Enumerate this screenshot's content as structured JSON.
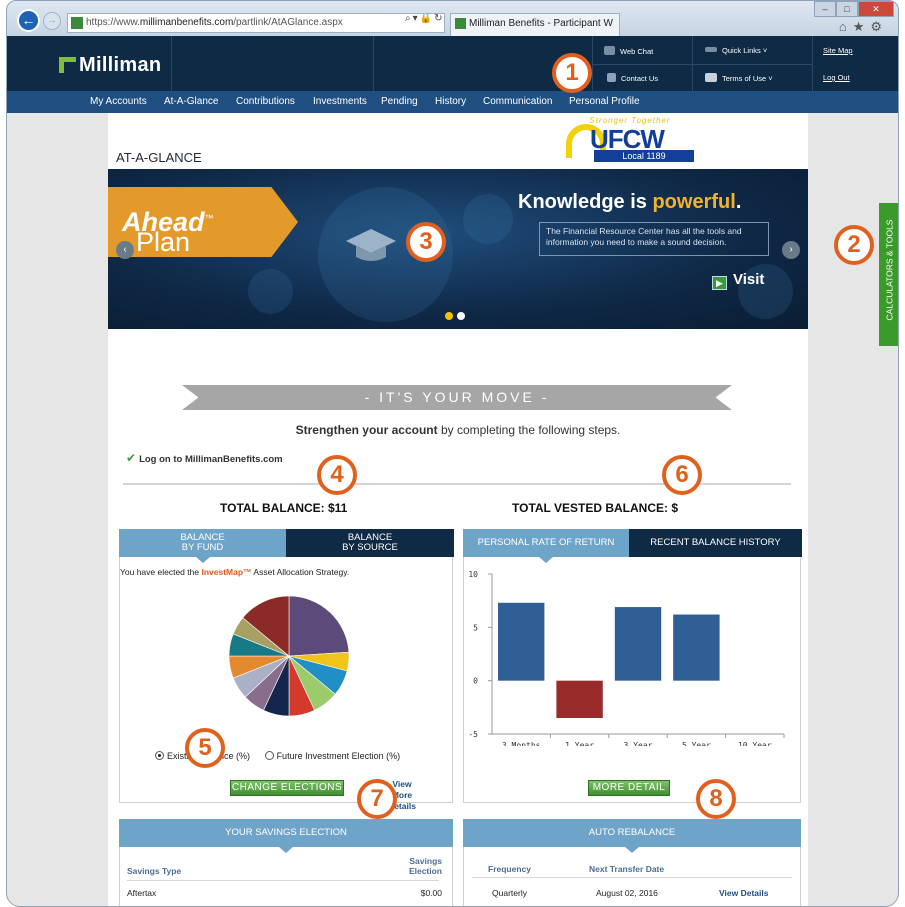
{
  "browser": {
    "url_prefix": "https://www.",
    "url_domain": "millimanbenefits.com",
    "url_path": "/partlink/AtAGlance.aspx",
    "tab_title": "Milliman Benefits - Participant W"
  },
  "header": {
    "logo": "Milliman",
    "web_chat": "Web Chat",
    "quick_links": "Quick Links",
    "site_map": "Site Map",
    "contact_us": "Contact Us",
    "terms_of_use": "Terms of Use",
    "log_out": "Log Out"
  },
  "nav": {
    "items": [
      "My Accounts",
      "At-A-Glance",
      "Contributions",
      "Investments",
      "Pending",
      "History",
      "Communication",
      "Personal Profile"
    ]
  },
  "page": {
    "title": "AT-A-GLANCE",
    "union_top": "Stronger Together",
    "union_name": "UFCW",
    "union_local": "Local 1189"
  },
  "banner": {
    "plan": "Plan",
    "ahead": "Ahead",
    "tm": "™",
    "headline_start": "Knowledge is ",
    "headline_highlight": "powerful",
    "headline_end": ".",
    "body": "The Financial Resource Center has all the tools and information you need to make a sound decision.",
    "visit": "Visit",
    "prev": "‹",
    "next": "›"
  },
  "move": {
    "title": "- IT'S YOUR MOVE -",
    "steps_bold": "Strengthen your account",
    "steps_rest": " by completing the following steps.",
    "logon": "Log on to MillimanBenefits.com"
  },
  "balances": {
    "total_label": "TOTAL BALANCE: $11",
    "vested_label": "TOTAL VESTED BALANCE: $"
  },
  "fund_panel": {
    "tab_fund_1": "BALANCE",
    "tab_fund_2": "BY FUND",
    "tab_source_1": "BALANCE",
    "tab_source_2": "BY SOURCE",
    "elected_pre": "You have elected the ",
    "elected_brand": "InvestMap™",
    "elected_post": " Asset Allocation Strategy.",
    "radio_existing": "Existing Balance (%)",
    "radio_future": "Future Investment Election (%)",
    "change_button": "CHANGE ELECTIONS",
    "view_more_1": "View More",
    "view_more_2": "Details"
  },
  "return_panel": {
    "tab_rate": "PERSONAL RATE OF RETURN",
    "tab_history": "RECENT BALANCE HISTORY",
    "more_button": "MORE DETAIL"
  },
  "savings": {
    "header": "YOUR SAVINGS ELECTION",
    "col_type": "Savings Type",
    "col_election_1": "Savings",
    "col_election_2": "Election",
    "row_type": "Aftertax",
    "row_value": "$0.00"
  },
  "rebalance": {
    "header": "AUTO REBALANCE",
    "col_frequency": "Frequency",
    "col_next": "Next Transfer Date",
    "row_frequency": "Quarterly",
    "row_next": "August 02, 2016",
    "row_link": "View Details"
  },
  "sidebar": {
    "label": "CALCULATORS & TOOLS"
  },
  "callouts": [
    "1",
    "2",
    "3",
    "4",
    "5",
    "6",
    "7",
    "8"
  ],
  "colors": {
    "navy": "#0e2a44",
    "nav_blue": "#1f4f80",
    "panel_blue": "#6fa4c9",
    "accent_orange": "#e0611d",
    "green": "#3f8f2f"
  },
  "chart_data": [
    {
      "type": "pie",
      "title": "",
      "slices": [
        {
          "value": 24,
          "color": "#5b4a7a"
        },
        {
          "value": 5,
          "color": "#f0c419"
        },
        {
          "value": 7,
          "color": "#1f8fc5"
        },
        {
          "value": 7,
          "color": "#9ccb6b"
        },
        {
          "value": 7,
          "color": "#d33a2c"
        },
        {
          "value": 7,
          "color": "#13274d"
        },
        {
          "value": 6,
          "color": "#8a6c8c"
        },
        {
          "value": 6,
          "color": "#aab1c7"
        },
        {
          "value": 6,
          "color": "#e3892f"
        },
        {
          "value": 6,
          "color": "#177a86"
        },
        {
          "value": 5,
          "color": "#a7a062"
        },
        {
          "value": 14,
          "color": "#8b2a26"
        }
      ]
    },
    {
      "type": "bar",
      "title": "",
      "categories": [
        "3 Months",
        "1 Year",
        "3 Year",
        "5 Year",
        "10 Year"
      ],
      "values": [
        7.3,
        -3.5,
        6.9,
        6.2,
        null
      ],
      "colors": [
        "#2f5f94",
        "#9a2b2b",
        "#2f5f94",
        "#2f5f94",
        "#2f5f94"
      ],
      "ylim": [
        -5,
        10
      ],
      "yticks": [
        -5,
        0,
        5,
        10
      ],
      "xlabel": "",
      "ylabel": ""
    }
  ]
}
